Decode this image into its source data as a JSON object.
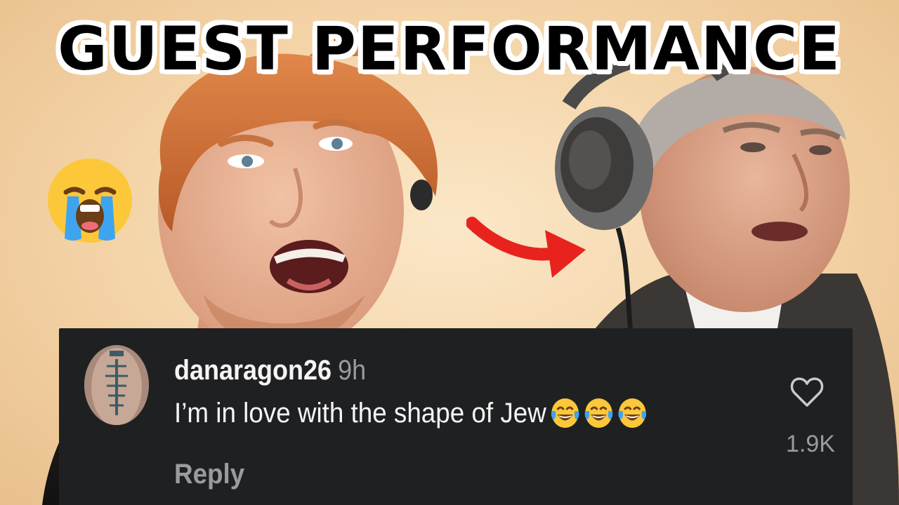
{
  "thumbnail": {
    "headline": "GUEST PERFORMANCE",
    "colors": {
      "background": "#f3d3a6",
      "headline_fill": "#000000",
      "headline_outline": "#ffffff",
      "arrow": "#e8231e",
      "comment_card": "#1f2022",
      "muted_text": "#9a9b9e"
    },
    "sticker_icon": "loudly-crying-face-emoji"
  },
  "comment": {
    "username": "danaragon26",
    "timestamp": "9h",
    "text": "I’m in love with the shape of Jew",
    "emojis": [
      "face-with-tears-of-joy",
      "face-with-tears-of-joy",
      "face-with-tears-of-joy"
    ],
    "reply_label": "Reply",
    "like_icon": "heart-outline-icon",
    "like_count": "1.9K"
  }
}
